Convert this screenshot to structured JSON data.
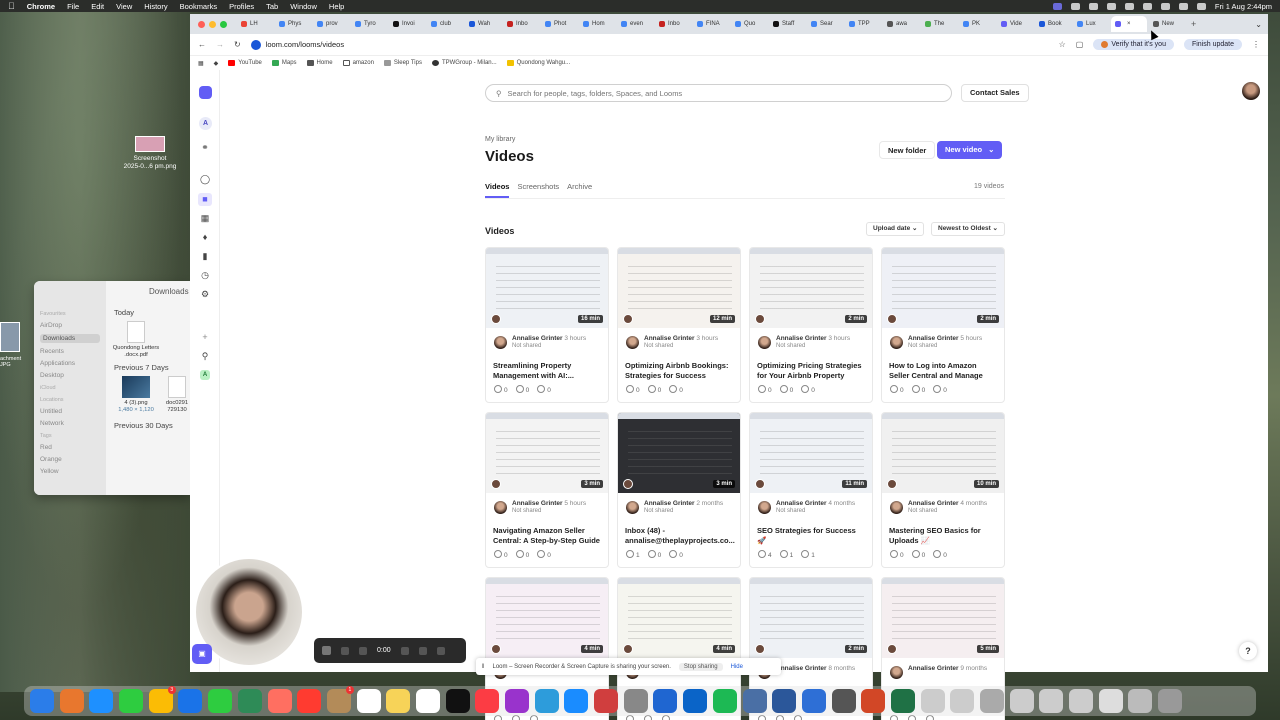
{
  "menubar": {
    "app": "Chrome",
    "items": [
      "File",
      "Edit",
      "View",
      "History",
      "Bookmarks",
      "Profiles",
      "Tab",
      "Window",
      "Help"
    ],
    "datetime": "Fri 1 Aug 2:44pm"
  },
  "desktop": {
    "file_label_1": "Screenshot",
    "file_label_2": "2025-0...6 pm.png",
    "sliver_label": "achment\nJPG"
  },
  "finder": {
    "title": "Downloads",
    "sidebar": [
      "Favourites",
      "AirDrop",
      "Downloads",
      "Recents",
      "Applications",
      "Desktop",
      "iCloud",
      "Locations",
      "Untitled",
      "Network",
      "Tags",
      "Red",
      "Orange",
      "Yellow"
    ],
    "section_today": "Today",
    "item_today": "Quondong Letters .docx.pdf",
    "section_7days": "Previous 7 Days",
    "item_a": "4 (3).png",
    "item_a_sub": "1,480 × 1,120",
    "item_b": "doc0291 729130",
    "section_30days": "Previous 30 Days"
  },
  "browser": {
    "tabs": [
      "LH",
      "Phys",
      "prov",
      "Tyro",
      "Invoi",
      "club",
      "Wah",
      "Inbo",
      "Phot",
      "Hom",
      "even",
      "Inbo",
      "FINA",
      "Quo",
      "Staff",
      "Sear",
      "TPP",
      "awa",
      "The",
      "PK",
      "Vide",
      "Book",
      "Lux",
      "",
      "New"
    ],
    "tab_colors": [
      "#ea4335",
      "#4285f4",
      "#4285f4",
      "#4285f4",
      "#111111",
      "#4285f4",
      "#1a57d8",
      "#c5221f",
      "#4285f4",
      "#4285f4",
      "#4285f4",
      "#c5221f",
      "#4285f4",
      "#4285f4",
      "#111111",
      "#4285f4",
      "#4285f4",
      "#555555",
      "#4caf50",
      "#4285f4",
      "#625df5",
      "#1a57d8",
      "#4285f4",
      "#625df5",
      "#555555"
    ],
    "url": "loom.com/looms/videos",
    "verify_label": "Verify that it's you",
    "finish_update": "Finish update",
    "bookmarks": [
      "YouTube",
      "Maps",
      "Home",
      "amazon",
      "Sleep Tips",
      "TPWGroup - Milan...",
      "Quondong Wahgu..."
    ]
  },
  "loom": {
    "search_placeholder": "Search for people, tags, folders, Spaces, and Looms",
    "contact_sales": "Contact Sales",
    "rail_a": "A",
    "rail_a2": "A",
    "breadcrumb": "My library",
    "page_title": "Videos",
    "new_folder": "New folder",
    "new_video": "New video",
    "tabs": [
      "Videos",
      "Screenshots",
      "Archive"
    ],
    "video_count": "19 videos",
    "section_title": "Videos",
    "sort_upload": "Upload date",
    "sort_order": "Newest to Oldest",
    "cards": [
      {
        "duration": "16 min",
        "author": "Annalise Grinter",
        "age": "3 hours",
        "share": "Not shared",
        "title": "Streamlining Property Management with AI:...",
        "views": "0",
        "comments": "0",
        "reactions": "0"
      },
      {
        "duration": "12 min",
        "author": "Annalise Grinter",
        "age": "3 hours",
        "share": "Not shared",
        "title": "Optimizing Airbnb Bookings: Strategies for Success",
        "views": "0",
        "comments": "0",
        "reactions": "0"
      },
      {
        "duration": "2 min",
        "author": "Annalise Grinter",
        "age": "3 hours",
        "share": "Not shared",
        "title": "Optimizing Pricing Strategies for Your Airbnb Property",
        "views": "0",
        "comments": "0",
        "reactions": "0"
      },
      {
        "duration": "2 min",
        "author": "Annalise Grinter",
        "age": "5 hours",
        "share": "Not shared",
        "title": "How to Log into Amazon Seller Central and Manage Your...",
        "views": "0",
        "comments": "0",
        "reactions": "0"
      },
      {
        "duration": "3 min",
        "author": "Annalise Grinter",
        "age": "5 hours",
        "share": "Not shared",
        "title": "Navigating Amazon Seller Central: A Step-by-Step Guide",
        "views": "0",
        "comments": "0",
        "reactions": "0"
      },
      {
        "duration": "3 min",
        "author": "Annalise Grinter",
        "age": "2 months",
        "share": "Not shared",
        "title": "Inbox (48) - annalise@theplayprojects.co...",
        "views": "1",
        "comments": "0",
        "reactions": "0"
      },
      {
        "duration": "11 min",
        "author": "Annalise Grinter",
        "age": "4 months",
        "share": "Not shared",
        "title": "SEO Strategies for Success 🚀",
        "views": "4",
        "comments": "1",
        "reactions": "1"
      },
      {
        "duration": "10 min",
        "author": "Annalise Grinter",
        "age": "4 months",
        "share": "Not shared",
        "title": "Mastering SEO Basics for Uploads 📈",
        "views": "0",
        "comments": "0",
        "reactions": "0"
      },
      {
        "duration": "4 min",
        "author": "",
        "age": "",
        "share": "",
        "title": "",
        "views": "",
        "comments": "",
        "reactions": ""
      },
      {
        "duration": "4 min",
        "author": "",
        "age": "",
        "share": "",
        "title": "",
        "views": "",
        "comments": "",
        "reactions": ""
      },
      {
        "duration": "2 min",
        "author": "Annalise Grinter",
        "age": "8 months",
        "share": "",
        "title": "",
        "views": "",
        "comments": "",
        "reactions": ""
      },
      {
        "duration": "5 min",
        "author": "Annalise Grinter",
        "age": "9 months",
        "share": "",
        "title": "",
        "views": "",
        "comments": "",
        "reactions": ""
      }
    ],
    "sharing_text": "Loom – Screen Recorder & Screen Capture is sharing your screen.",
    "stop_sharing": "Stop sharing",
    "hide": "Hide",
    "help": "?"
  },
  "recorder": {
    "time": "0:00"
  },
  "dock": {
    "app_colors": [
      "#2b7de9",
      "#e8772e",
      "#1e90ff",
      "#2ecc40",
      "#fbbc05",
      "#1a73e8",
      "#2ecc40",
      "#2e8b57",
      "#ff6f61",
      "#ff3b30",
      "#b38b59",
      "#ffffff",
      "#f7d358",
      "#ffffff",
      "#111111",
      "#fc3c44",
      "#9933cc",
      "#2d9cdb",
      "#1a8cff",
      "#d03e3e",
      "#888888",
      "#1f66d1",
      "#0a64c8",
      "#1db954",
      "#4a6fa5",
      "#2b579a",
      "#2e6fd6",
      "#555555",
      "#d24726",
      "#1f7145",
      "#cccccc",
      "#cccccc",
      "#aaaaaa",
      "#cccccc",
      "#cccccc",
      "#cccccc",
      "#dddddd",
      "#bbbbbb",
      "#999999"
    ],
    "badges": {
      "4": "3",
      "10": "1"
    }
  }
}
